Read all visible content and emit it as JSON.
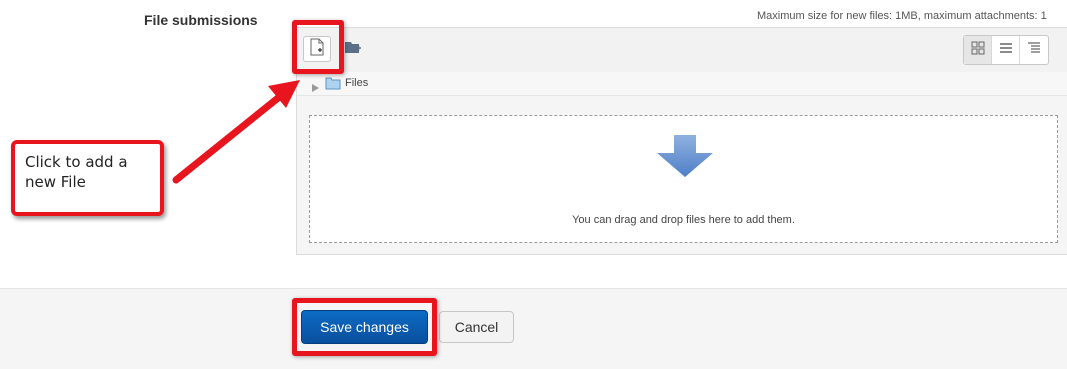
{
  "field": {
    "label": "File submissions",
    "limits": "Maximum size for new files: 1MB, maximum attachments: 1"
  },
  "filepicker": {
    "toolbar": {
      "add_icon": "add-file-icon",
      "mkdir_icon": "create-folder-icon",
      "views": [
        {
          "icon": "icon-view-icon",
          "active": true
        },
        {
          "icon": "list-view-icon",
          "active": false
        },
        {
          "icon": "tree-view-icon",
          "active": false
        }
      ]
    },
    "path_label": "Files",
    "drop_text": "You can drag and drop files here to add them."
  },
  "buttons": {
    "save": "Save changes",
    "cancel": "Cancel"
  },
  "annotation": {
    "callout": "Click to add a new File",
    "color": "#e8141e"
  }
}
